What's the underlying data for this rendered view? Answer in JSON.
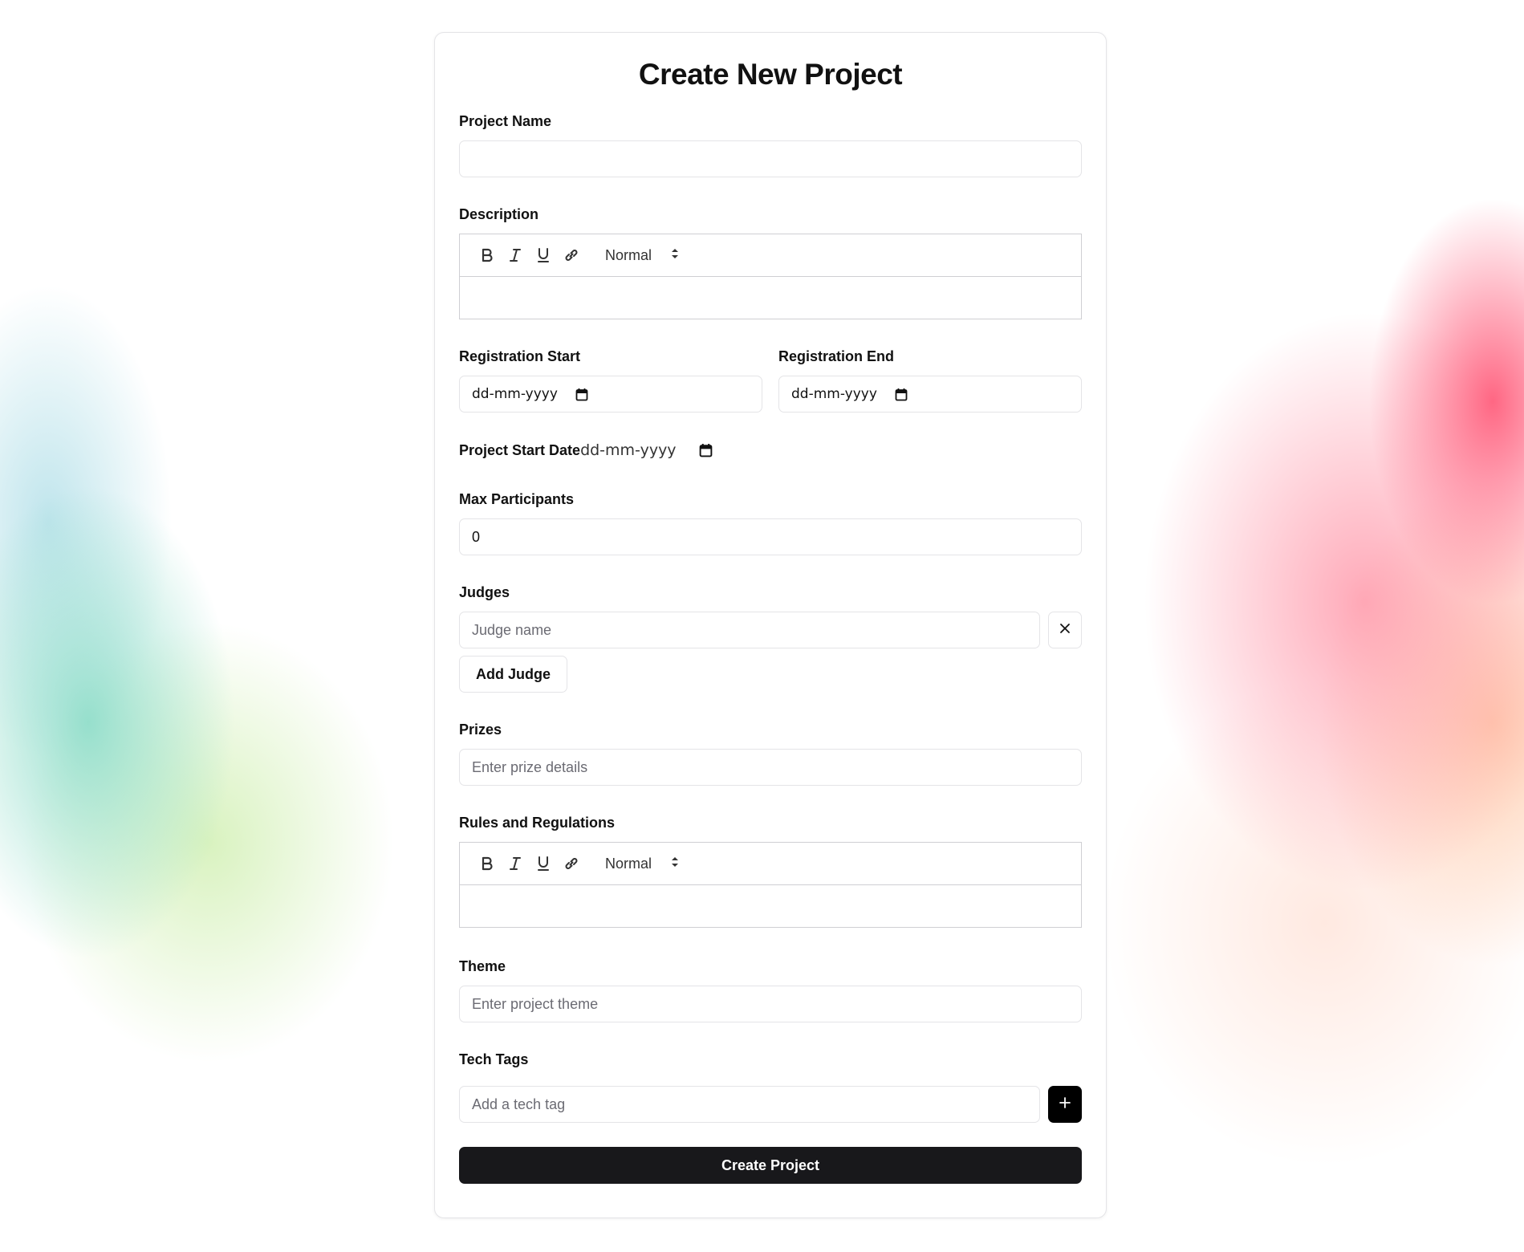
{
  "form": {
    "title": "Create New Project",
    "project_name": {
      "label": "Project Name",
      "value": ""
    },
    "description": {
      "label": "Description",
      "format_select": "Normal"
    },
    "registration_start": {
      "label": "Registration Start",
      "value": "dd-mm-yyyy"
    },
    "registration_end": {
      "label": "Registration End",
      "value": "dd-mm-yyyy"
    },
    "project_start_date": {
      "label": "Project Start Date",
      "value": "dd-mm-yyyy"
    },
    "max_participants": {
      "label": "Max Participants",
      "value": "0"
    },
    "judges": {
      "label": "Judges",
      "placeholder": "Judge name",
      "add_label": "Add Judge"
    },
    "prizes": {
      "label": "Prizes",
      "placeholder": "Enter prize details"
    },
    "rules": {
      "label": "Rules and Regulations",
      "format_select": "Normal"
    },
    "theme": {
      "label": "Theme",
      "placeholder": "Enter project theme"
    },
    "tech_tags": {
      "label": "Tech Tags",
      "placeholder": "Add a tech tag"
    },
    "submit_label": "Create Project"
  },
  "icons": {
    "bold": "bold-icon",
    "italic": "italic-icon",
    "underline": "underline-icon",
    "link": "link-icon",
    "calendar": "calendar-icon",
    "close": "close-icon",
    "plus": "plus-icon"
  },
  "colors": {
    "primary": "#18181b",
    "border": "#e4e4e7",
    "placeholder": "#6b6b73"
  }
}
